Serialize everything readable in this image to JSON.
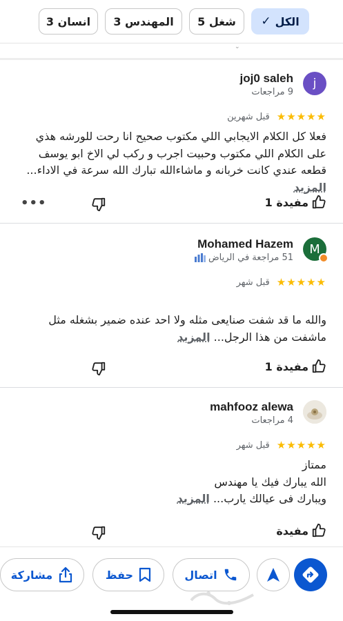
{
  "filters": {
    "chips": [
      {
        "label": "الكل",
        "selected": true
      },
      {
        "label": "شغل 5",
        "selected": false
      },
      {
        "label": "المهندس 3",
        "selected": false
      },
      {
        "label": "انسان 3",
        "selected": false
      }
    ]
  },
  "reviews": [
    {
      "name": "joj0 saleh",
      "avatar_letter": "j",
      "subtitle": "9 مراجعات",
      "stars": "★★★★★",
      "rating": 5,
      "time": "قبل شهرين",
      "text": "فعلا كل الكلام الايجابي اللي مكتوب صحيح انا رحت للورشه هذي على الكلام اللي مكتوب وحبيت اجرب و ركب لي الاخ ابو يوسف قطعه عندي كانت خربانه و ماشاءالله تبارك الله سرعة في الاداء...",
      "more_label": "المزيد",
      "helpful_label": "مفيدة 1"
    },
    {
      "name": "Mohamed Hazem",
      "avatar_letter": "M",
      "subtitle": "51 مراجعة في الرياض",
      "stars": "★★★★★",
      "rating": 5,
      "time": "قبل شهر",
      "text": "والله ما قد شفت صنايعى مثله ولا احد عنده ضمير بشغله مثل ماشفت من هذا الرجل...",
      "more_label": "المزيد",
      "helpful_label": "مفيدة 1"
    },
    {
      "name": "mahfooz alewa",
      "subtitle": "4 مراجعات",
      "stars": "★★★★★",
      "rating": 5,
      "time": "قبل شهر",
      "text_lines": [
        "ممتاز",
        "الله يبارك فيك يا مهندس",
        "ويبارك فى عيالك يارب..."
      ],
      "more_label": "المزيد",
      "helpful_label": "مفيدة"
    }
  ],
  "bottom_bar": {
    "share_label": "مشاركة",
    "save_label": "حفظ",
    "call_label": "اتصال"
  },
  "colors": {
    "accent": "#0b57d0",
    "star": "#fbbc04",
    "chip_selected": "#d3e3fd"
  }
}
